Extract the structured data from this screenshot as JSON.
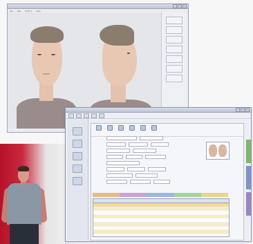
{
  "back_window": {
    "title": "",
    "menu": [
      "File",
      "Edit",
      "Options",
      "Help"
    ],
    "side_buttons": [
      "",
      "",
      "",
      "",
      "",
      "",
      ""
    ]
  },
  "front_window": {
    "title": "",
    "ribbon": [
      "",
      "",
      "",
      "",
      "",
      ""
    ],
    "grid": {
      "columns": [
        "",
        "",
        "",
        ""
      ],
      "rows": [
        [
          "",
          "",
          "",
          ""
        ],
        [
          "",
          "",
          "",
          ""
        ],
        [
          "",
          "",
          "",
          ""
        ],
        [
          "",
          "",
          "",
          ""
        ],
        [
          "",
          "",
          "",
          ""
        ],
        [
          "",
          "",
          "",
          ""
        ],
        [
          "",
          "",
          "",
          ""
        ],
        [
          "",
          "",
          "",
          ""
        ]
      ]
    }
  },
  "colors": {
    "selected_row": "#f4dc8a",
    "highlight_row": "#f7ecc0",
    "tab_green": "#7fb86a",
    "tab_blue": "#7e93c8",
    "tab_purple": "#9a86c2",
    "red_backdrop": "#b5122a"
  }
}
